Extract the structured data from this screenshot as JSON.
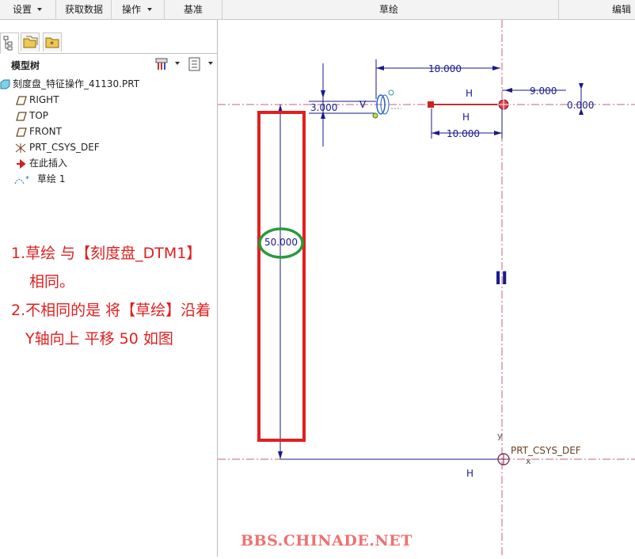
{
  "menubar": {
    "items": [
      {
        "label": "设置",
        "has_dropdown": true
      },
      {
        "label": "获取数据",
        "has_dropdown": false
      },
      {
        "label": "操作",
        "has_dropdown": true
      },
      {
        "label": "基准",
        "has_dropdown": false
      },
      {
        "label": "草绘",
        "has_dropdown": false
      },
      {
        "label": "编辑",
        "has_dropdown": false
      }
    ]
  },
  "panel": {
    "title": "模型树",
    "tree": [
      {
        "label": "刻度盘_特征操作_41130.PRT",
        "icon": "part-icon"
      },
      {
        "label": "RIGHT",
        "icon": "datum-plane-icon"
      },
      {
        "label": "TOP",
        "icon": "datum-plane-icon"
      },
      {
        "label": "FRONT",
        "icon": "datum-plane-icon"
      },
      {
        "label": "PRT_CSYS_DEF",
        "icon": "csys-icon"
      },
      {
        "label": "在此插入",
        "icon": "insert-arrow-icon"
      },
      {
        "label": "草绘 1",
        "icon": "sketch-icon"
      }
    ]
  },
  "notes": {
    "line1": "1.草绘 与【刻度盘_DTM1】",
    "line2": "相同。",
    "line3": "2.不相同的是 将【草绘】沿着",
    "line4": "Y轴向上 平移 50  如图"
  },
  "sketch": {
    "dim_18": "18.000",
    "dim_9": "9.000",
    "dim_3": "3.000",
    "dim_10": "10.000",
    "dim_0": "0.000",
    "dim_50": "50.000",
    "constraint_h1": "H",
    "constraint_h2": "H",
    "constraint_h3": "H",
    "constraint_v": "V",
    "parallel_symbol": "II",
    "csys_label": "PRT_CSYS_DEF",
    "axis_y": "y",
    "axis_x": "x"
  },
  "watermark": "BBS.CHINADE.NET",
  "colors": {
    "dimension": "#1a1a8c",
    "centerline": "#c06080",
    "annotation_red": "#e02020",
    "highlight_green": "#2a9a3a",
    "watermark": "#f07070"
  }
}
